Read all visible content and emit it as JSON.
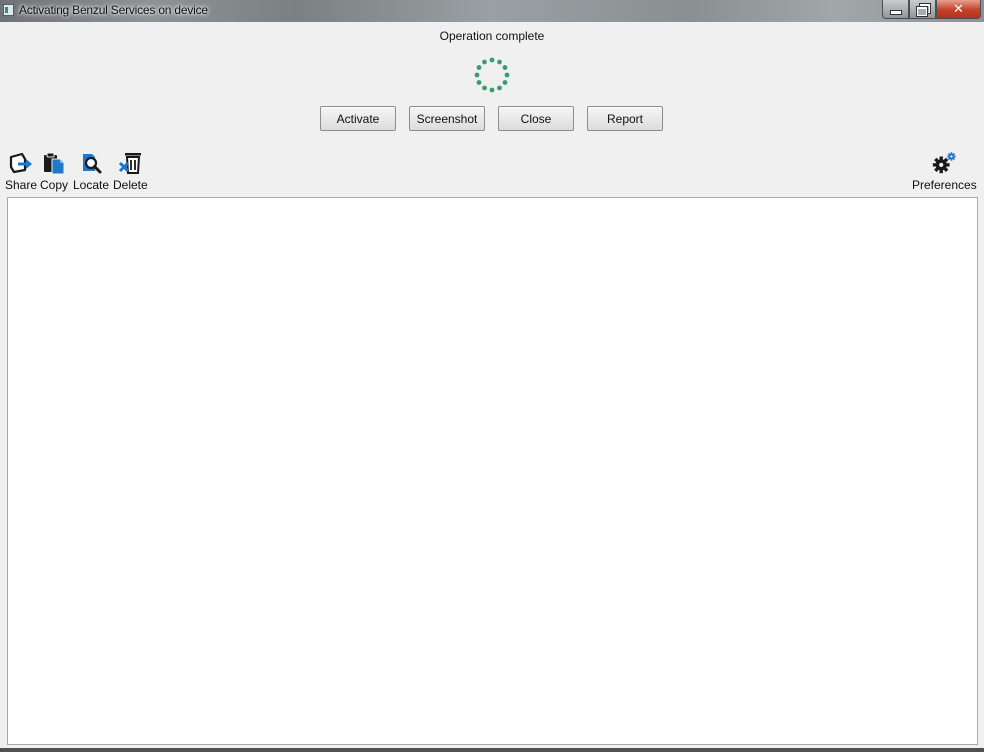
{
  "window": {
    "title": "Activating Benzul Services on device",
    "controls": {
      "minimize_icon": "minimize-icon",
      "maximize_icon": "restore-icon",
      "close_icon": "close-icon",
      "close_glyph": "✕"
    }
  },
  "status": {
    "text": "Operation complete",
    "spinner_color": "#3a9a72"
  },
  "actions": {
    "activate_label": "Activate",
    "screenshot_label": "Screenshot",
    "close_label": "Close",
    "report_label": "Report"
  },
  "toolbar": {
    "share_label": "Share",
    "copy_label": "Copy",
    "locate_label": "Locate",
    "delete_label": "Delete",
    "preferences_label": "Preferences",
    "accent_color": "#1f78c8"
  }
}
